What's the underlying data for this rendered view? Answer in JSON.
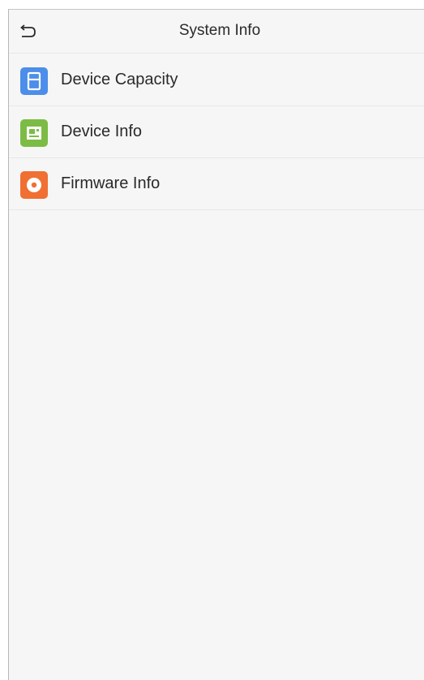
{
  "header": {
    "title": "System Info",
    "back_icon": "back-arrow-icon"
  },
  "menu": {
    "items": [
      {
        "label": "Device Capacity",
        "icon": "storage-icon",
        "color": "#4c8ee9"
      },
      {
        "label": "Device Info",
        "icon": "device-icon",
        "color": "#7cbc45"
      },
      {
        "label": "Firmware Info",
        "icon": "firmware-icon",
        "color": "#f06f32"
      }
    ]
  },
  "colors": {
    "background": "#f6f6f6",
    "divider": "#e8e8e8",
    "text": "#2a2a2a"
  }
}
